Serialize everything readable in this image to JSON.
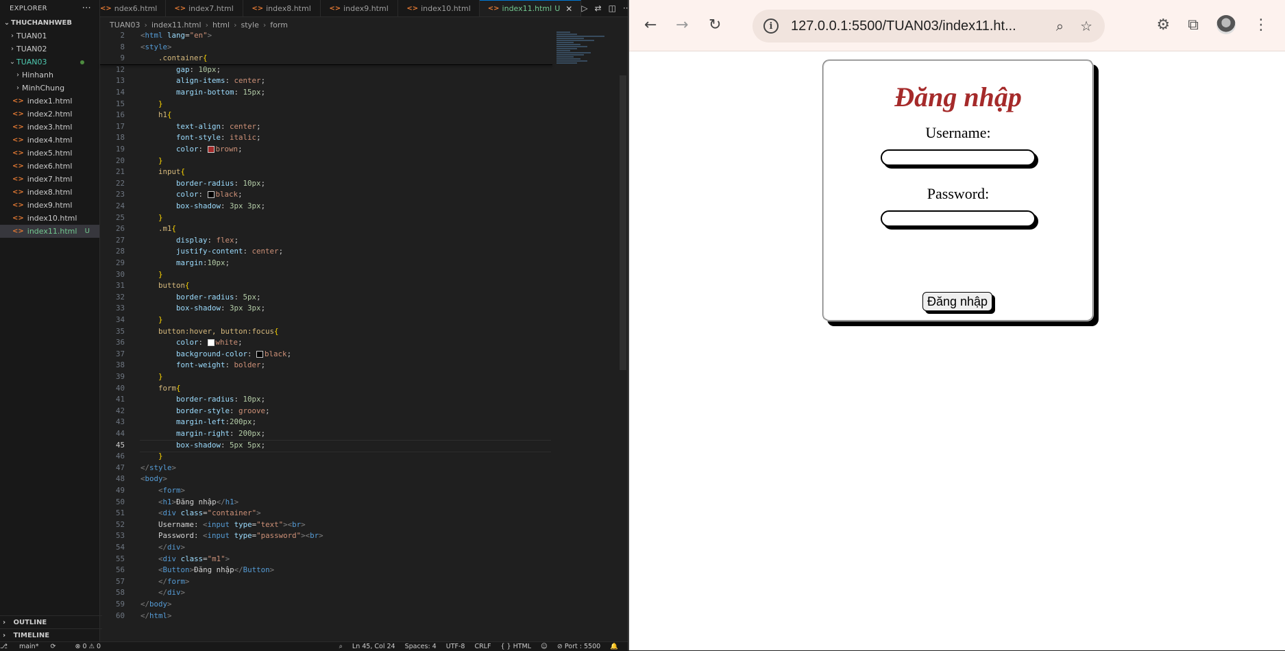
{
  "explorer": {
    "header": "EXPLORER",
    "workspace": "THUCHANHWEB",
    "folders_top": [
      "TUAN01",
      "TUAN02"
    ],
    "active_folder": "TUAN03",
    "subfolders": [
      "Hinhanh",
      "MinhChung"
    ],
    "files": [
      "index1.html",
      "index2.html",
      "index3.html",
      "index4.html",
      "index5.html",
      "index6.html",
      "index7.html",
      "index8.html",
      "index9.html",
      "index10.html",
      "index11.html"
    ],
    "file_badge": "U",
    "outline": "OUTLINE",
    "timeline": "TIMELINE"
  },
  "tabs": [
    {
      "label": "ndex6.html"
    },
    {
      "label": "index7.html"
    },
    {
      "label": "index8.html"
    },
    {
      "label": "index9.html"
    },
    {
      "label": "index10.html"
    },
    {
      "label": "index11.html",
      "badge": "U",
      "active": true
    }
  ],
  "breadcrumb": [
    "TUAN03",
    "index11.html",
    "html",
    "style",
    "form"
  ],
  "code": [
    {
      "n": "2",
      "tokens": [
        [
          "ang",
          "<"
        ],
        [
          "tag",
          "html"
        ],
        [
          "txt",
          " "
        ],
        [
          "attr",
          "lang"
        ],
        [
          "pun",
          "="
        ],
        [
          "str",
          "\"en\""
        ],
        [
          "ang",
          ">"
        ]
      ]
    },
    {
      "n": "8",
      "tokens": [
        [
          "ang",
          "<"
        ],
        [
          "tag",
          "style"
        ],
        [
          "ang",
          ">"
        ]
      ]
    },
    {
      "n": "9",
      "tokens": [
        [
          "txt",
          "    "
        ],
        [
          "sel",
          ".container"
        ],
        [
          "br",
          "{"
        ]
      ]
    },
    {
      "n": "12",
      "tokens": [
        [
          "txt",
          "        "
        ],
        [
          "prop",
          "gap"
        ],
        [
          "pun",
          ": "
        ],
        [
          "num",
          "10px"
        ],
        [
          "pun",
          ";"
        ]
      ]
    },
    {
      "n": "13",
      "tokens": [
        [
          "txt",
          "        "
        ],
        [
          "prop",
          "align-items"
        ],
        [
          "pun",
          ": "
        ],
        [
          "val",
          "center"
        ],
        [
          "pun",
          ";"
        ]
      ]
    },
    {
      "n": "14",
      "tokens": [
        [
          "txt",
          "        "
        ],
        [
          "prop",
          "margin-bottom"
        ],
        [
          "pun",
          ": "
        ],
        [
          "num",
          "15px"
        ],
        [
          "pun",
          ";"
        ]
      ]
    },
    {
      "n": "15",
      "tokens": [
        [
          "txt",
          "    "
        ],
        [
          "br",
          "}"
        ]
      ]
    },
    {
      "n": "16",
      "tokens": [
        [
          "txt",
          "    "
        ],
        [
          "sel",
          "h1"
        ],
        [
          "br",
          "{"
        ]
      ]
    },
    {
      "n": "17",
      "tokens": [
        [
          "txt",
          "        "
        ],
        [
          "prop",
          "text-align"
        ],
        [
          "pun",
          ": "
        ],
        [
          "val",
          "center"
        ],
        [
          "pun",
          ";"
        ]
      ]
    },
    {
      "n": "18",
      "tokens": [
        [
          "txt",
          "        "
        ],
        [
          "prop",
          "font-style"
        ],
        [
          "pun",
          ": "
        ],
        [
          "val",
          "italic"
        ],
        [
          "pun",
          ";"
        ]
      ]
    },
    {
      "n": "19",
      "tokens": [
        [
          "txt",
          "        "
        ],
        [
          "prop",
          "color"
        ],
        [
          "pun",
          ": "
        ],
        [
          "sw",
          "#a52a2a"
        ],
        [
          "val",
          "brown"
        ],
        [
          "pun",
          ";"
        ]
      ]
    },
    {
      "n": "20",
      "tokens": [
        [
          "txt",
          "    "
        ],
        [
          "br",
          "}"
        ]
      ]
    },
    {
      "n": "21",
      "tokens": [
        [
          "txt",
          "    "
        ],
        [
          "sel",
          "input"
        ],
        [
          "br",
          "{"
        ]
      ]
    },
    {
      "n": "22",
      "tokens": [
        [
          "txt",
          "        "
        ],
        [
          "prop",
          "border-radius"
        ],
        [
          "pun",
          ": "
        ],
        [
          "num",
          "10px"
        ],
        [
          "pun",
          ";"
        ]
      ]
    },
    {
      "n": "23",
      "tokens": [
        [
          "txt",
          "        "
        ],
        [
          "prop",
          "color"
        ],
        [
          "pun",
          ": "
        ],
        [
          "sw",
          "#000000"
        ],
        [
          "val",
          "black"
        ],
        [
          "pun",
          ";"
        ]
      ]
    },
    {
      "n": "24",
      "tokens": [
        [
          "txt",
          "        "
        ],
        [
          "prop",
          "box-shadow"
        ],
        [
          "pun",
          ": "
        ],
        [
          "num",
          "3px 3px"
        ],
        [
          "pun",
          ";"
        ]
      ]
    },
    {
      "n": "25",
      "tokens": [
        [
          "txt",
          "    "
        ],
        [
          "br",
          "}"
        ]
      ]
    },
    {
      "n": "26",
      "tokens": [
        [
          "txt",
          "    "
        ],
        [
          "sel",
          ".m1"
        ],
        [
          "br",
          "{"
        ]
      ]
    },
    {
      "n": "27",
      "tokens": [
        [
          "txt",
          "        "
        ],
        [
          "prop",
          "display"
        ],
        [
          "pun",
          ": "
        ],
        [
          "val",
          "flex"
        ],
        [
          "pun",
          ";"
        ]
      ]
    },
    {
      "n": "28",
      "tokens": [
        [
          "txt",
          "        "
        ],
        [
          "prop",
          "justify-content"
        ],
        [
          "pun",
          ": "
        ],
        [
          "val",
          "center"
        ],
        [
          "pun",
          ";"
        ]
      ]
    },
    {
      "n": "29",
      "tokens": [
        [
          "txt",
          "        "
        ],
        [
          "prop",
          "margin"
        ],
        [
          "pun",
          ":"
        ],
        [
          "num",
          "10px"
        ],
        [
          "pun",
          ";"
        ]
      ]
    },
    {
      "n": "30",
      "tokens": [
        [
          "txt",
          "    "
        ],
        [
          "br",
          "}"
        ]
      ]
    },
    {
      "n": "31",
      "tokens": [
        [
          "txt",
          "    "
        ],
        [
          "sel",
          "button"
        ],
        [
          "br",
          "{"
        ]
      ]
    },
    {
      "n": "32",
      "tokens": [
        [
          "txt",
          "        "
        ],
        [
          "prop",
          "border-radius"
        ],
        [
          "pun",
          ": "
        ],
        [
          "num",
          "5px"
        ],
        [
          "pun",
          ";"
        ]
      ]
    },
    {
      "n": "33",
      "tokens": [
        [
          "txt",
          "        "
        ],
        [
          "prop",
          "box-shadow"
        ],
        [
          "pun",
          ": "
        ],
        [
          "num",
          "3px 3px"
        ],
        [
          "pun",
          ";"
        ]
      ]
    },
    {
      "n": "34",
      "tokens": [
        [
          "txt",
          "    "
        ],
        [
          "br",
          "}"
        ]
      ]
    },
    {
      "n": "35",
      "tokens": [
        [
          "txt",
          "    "
        ],
        [
          "sel",
          "button:hover, button:focus"
        ],
        [
          "br",
          "{"
        ]
      ]
    },
    {
      "n": "36",
      "tokens": [
        [
          "txt",
          "        "
        ],
        [
          "prop",
          "color"
        ],
        [
          "pun",
          ": "
        ],
        [
          "sw",
          "#ffffff"
        ],
        [
          "val",
          "white"
        ],
        [
          "pun",
          ";"
        ]
      ]
    },
    {
      "n": "37",
      "tokens": [
        [
          "txt",
          "        "
        ],
        [
          "prop",
          "background-color"
        ],
        [
          "pun",
          ": "
        ],
        [
          "sw",
          "#000000"
        ],
        [
          "val",
          "black"
        ],
        [
          "pun",
          ";"
        ]
      ]
    },
    {
      "n": "38",
      "tokens": [
        [
          "txt",
          "        "
        ],
        [
          "prop",
          "font-weight"
        ],
        [
          "pun",
          ": "
        ],
        [
          "val",
          "bolder"
        ],
        [
          "pun",
          ";"
        ]
      ]
    },
    {
      "n": "39",
      "tokens": [
        [
          "txt",
          "    "
        ],
        [
          "br",
          "}"
        ]
      ]
    },
    {
      "n": "40",
      "tokens": [
        [
          "txt",
          "    "
        ],
        [
          "sel",
          "form"
        ],
        [
          "br",
          "{"
        ]
      ]
    },
    {
      "n": "41",
      "tokens": [
        [
          "txt",
          "        "
        ],
        [
          "prop",
          "border-radius"
        ],
        [
          "pun",
          ": "
        ],
        [
          "num",
          "10px"
        ],
        [
          "pun",
          ";"
        ]
      ]
    },
    {
      "n": "42",
      "tokens": [
        [
          "txt",
          "        "
        ],
        [
          "prop",
          "border-style"
        ],
        [
          "pun",
          ": "
        ],
        [
          "val",
          "groove"
        ],
        [
          "pun",
          ";"
        ]
      ]
    },
    {
      "n": "43",
      "tokens": [
        [
          "txt",
          "        "
        ],
        [
          "prop",
          "margin-left"
        ],
        [
          "pun",
          ":"
        ],
        [
          "num",
          "200px"
        ],
        [
          "pun",
          ";"
        ]
      ]
    },
    {
      "n": "44",
      "tokens": [
        [
          "txt",
          "        "
        ],
        [
          "prop",
          "margin-right"
        ],
        [
          "pun",
          ": "
        ],
        [
          "num",
          "200px"
        ],
        [
          "pun",
          ";"
        ]
      ]
    },
    {
      "n": "45",
      "cur": true,
      "tokens": [
        [
          "txt",
          "        "
        ],
        [
          "prop",
          "box-shadow"
        ],
        [
          "pun",
          ": "
        ],
        [
          "num",
          "5px 5px"
        ],
        [
          "pun",
          ";"
        ]
      ]
    },
    {
      "n": "46",
      "tokens": [
        [
          "txt",
          "    "
        ],
        [
          "br",
          "}"
        ]
      ]
    },
    {
      "n": "47",
      "tokens": [
        [
          "ang",
          "</"
        ],
        [
          "tag",
          "style"
        ],
        [
          "ang",
          ">"
        ]
      ]
    },
    {
      "n": "48",
      "tokens": [
        [
          "ang",
          "<"
        ],
        [
          "tag",
          "body"
        ],
        [
          "ang",
          ">"
        ]
      ]
    },
    {
      "n": "49",
      "tokens": [
        [
          "txt",
          "    "
        ],
        [
          "ang",
          "<"
        ],
        [
          "tag",
          "form"
        ],
        [
          "ang",
          ">"
        ]
      ]
    },
    {
      "n": "50",
      "tokens": [
        [
          "txt",
          "    "
        ],
        [
          "ang",
          "<"
        ],
        [
          "tag",
          "h1"
        ],
        [
          "ang",
          ">"
        ],
        [
          "txt",
          "Đăng nhập"
        ],
        [
          "ang",
          "</"
        ],
        [
          "tag",
          "h1"
        ],
        [
          "ang",
          ">"
        ]
      ]
    },
    {
      "n": "51",
      "tokens": [
        [
          "txt",
          "    "
        ],
        [
          "ang",
          "<"
        ],
        [
          "tag",
          "div"
        ],
        [
          "txt",
          " "
        ],
        [
          "attr",
          "class"
        ],
        [
          "pun",
          "="
        ],
        [
          "str",
          "\"container\""
        ],
        [
          "ang",
          ">"
        ]
      ]
    },
    {
      "n": "52",
      "tokens": [
        [
          "txt",
          "    Username: "
        ],
        [
          "ang",
          "<"
        ],
        [
          "tag",
          "input"
        ],
        [
          "txt",
          " "
        ],
        [
          "attr",
          "type"
        ],
        [
          "pun",
          "="
        ],
        [
          "str",
          "\"text\""
        ],
        [
          "ang",
          "><"
        ],
        [
          "tag",
          "br"
        ],
        [
          "ang",
          ">"
        ]
      ]
    },
    {
      "n": "53",
      "tokens": [
        [
          "txt",
          "    Password: "
        ],
        [
          "ang",
          "<"
        ],
        [
          "tag",
          "input"
        ],
        [
          "txt",
          " "
        ],
        [
          "attr",
          "type"
        ],
        [
          "pun",
          "="
        ],
        [
          "str",
          "\"password\""
        ],
        [
          "ang",
          "><"
        ],
        [
          "tag",
          "br"
        ],
        [
          "ang",
          ">"
        ]
      ]
    },
    {
      "n": "54",
      "tokens": [
        [
          "txt",
          "    "
        ],
        [
          "ang",
          "</"
        ],
        [
          "tag",
          "div"
        ],
        [
          "ang",
          ">"
        ]
      ]
    },
    {
      "n": "55",
      "tokens": [
        [
          "txt",
          "    "
        ],
        [
          "ang",
          "<"
        ],
        [
          "tag",
          "div"
        ],
        [
          "txt",
          " "
        ],
        [
          "attr",
          "class"
        ],
        [
          "pun",
          "="
        ],
        [
          "str",
          "\"m1\""
        ],
        [
          "ang",
          ">"
        ]
      ]
    },
    {
      "n": "56",
      "tokens": [
        [
          "txt",
          "    "
        ],
        [
          "ang",
          "<"
        ],
        [
          "tag",
          "Button"
        ],
        [
          "ang",
          ">"
        ],
        [
          "txt",
          "Đăng nhập"
        ],
        [
          "ang",
          "</"
        ],
        [
          "tag",
          "Button"
        ],
        [
          "ang",
          ">"
        ]
      ]
    },
    {
      "n": "57",
      "tokens": [
        [
          "txt",
          "    "
        ],
        [
          "ang",
          "</"
        ],
        [
          "tag",
          "form"
        ],
        [
          "ang",
          ">"
        ]
      ]
    },
    {
      "n": "58",
      "tokens": [
        [
          "txt",
          "    "
        ],
        [
          "ang",
          "</"
        ],
        [
          "tag",
          "div"
        ],
        [
          "ang",
          ">"
        ]
      ]
    },
    {
      "n": "59",
      "tokens": [
        [
          "ang",
          "</"
        ],
        [
          "tag",
          "body"
        ],
        [
          "ang",
          ">"
        ]
      ]
    },
    {
      "n": "60",
      "tokens": [
        [
          "ang",
          "</"
        ],
        [
          "tag",
          "html"
        ],
        [
          "ang",
          ">"
        ]
      ]
    }
  ],
  "status": {
    "branch": "main*",
    "problems": "⊗ 0 ⚠ 0",
    "position": "Ln 45, Col 24",
    "spaces": "Spaces: 4",
    "encoding": "UTF-8",
    "eol": "CRLF",
    "language": "{ } HTML",
    "port": "⊘ Port : 5500"
  },
  "browser": {
    "url": "127.0.0.1:5500/TUAN03/index11.ht...",
    "page": {
      "title": "Đăng nhập",
      "username_label": "Username:",
      "password_label": "Password:",
      "button_label": "Đăng nhập"
    }
  }
}
